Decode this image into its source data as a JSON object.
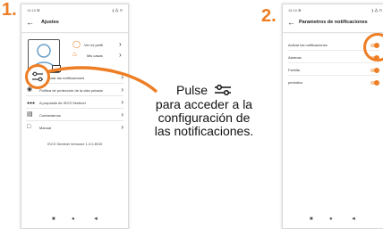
{
  "steps": {
    "one": "1.",
    "two": "2."
  },
  "colors": {
    "accent": "#ee7d23"
  },
  "phone1": {
    "status_left": "15:16 ⊠",
    "status_right": "∦ ⁂ ⊡",
    "title": "Ajustes",
    "profile_label": "Ver mi perfil",
    "homes_label": "Mis casas",
    "menu": [
      {
        "icon": "sliders-icon",
        "label": "Configurar las notificaciones"
      },
      {
        "icon": "privacy-icon",
        "label": "Política de protección de la vida privada"
      },
      {
        "icon": "dots-icon",
        "label": "A propósito de ISCS Sentinel"
      },
      {
        "icon": "contact-icon",
        "label": "Contactarnos"
      },
      {
        "icon": "manual-icon",
        "label": "Manual"
      }
    ],
    "version": "ISCS Sentinel Versione 1.0.0-BCB"
  },
  "callout": {
    "line1": "Pulse",
    "line2": "para acceder a la",
    "line3": "configuración de",
    "line4": "las notificaciones."
  },
  "phone2": {
    "status_left": "15:16 ⊠",
    "status_right": "∦ ⁂ ⊡",
    "title": "Parametros de notificaciones",
    "rows": [
      {
        "label": "Activar las notificaciones",
        "on": true
      },
      {
        "label": "Alarmas",
        "on": true
      },
      {
        "label": "Familia",
        "on": true
      },
      {
        "label": "periódico",
        "on": true
      }
    ]
  },
  "navbar": {
    "square": "■",
    "circle": "●",
    "back": "◄"
  }
}
